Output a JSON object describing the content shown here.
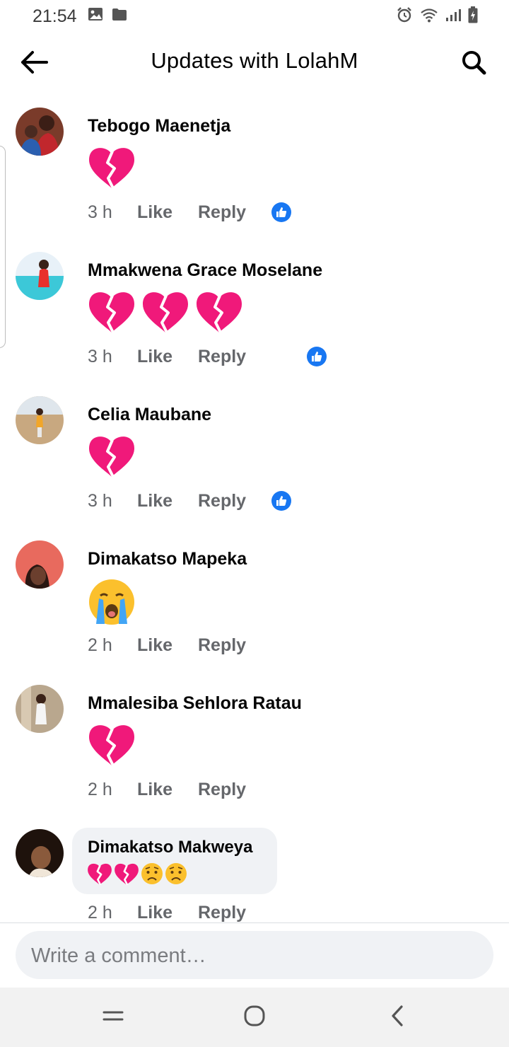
{
  "status_bar": {
    "time": "21:54"
  },
  "header": {
    "title": "Updates with LolahM"
  },
  "comments": [
    {
      "author": "Tebogo Maenetja",
      "reactions": [
        "broken-heart"
      ],
      "time": "3 h",
      "like": "Like",
      "reply": "Reply",
      "likes": "1"
    },
    {
      "author": "Mmakwena Grace Moselane",
      "reactions": [
        "broken-heart",
        "broken-heart",
        "broken-heart"
      ],
      "time": "3 h",
      "like": "Like",
      "reply": "Reply",
      "likes": "1"
    },
    {
      "author": "Celia Maubane",
      "reactions": [
        "broken-heart"
      ],
      "time": "3 h",
      "like": "Like",
      "reply": "Reply",
      "likes": "1"
    },
    {
      "author": "Dimakatso Mapeka",
      "reactions": [
        "loudly-crying-face"
      ],
      "time": "2 h",
      "like": "Like",
      "reply": "Reply"
    },
    {
      "author": "Mmalesiba Sehlora Ratau",
      "reactions": [
        "broken-heart"
      ],
      "time": "2 h",
      "like": "Like",
      "reply": "Reply"
    },
    {
      "author": "Dimakatso Makweya",
      "reactions": [
        "broken-heart",
        "broken-heart",
        "worried-face",
        "worried-face"
      ],
      "time": "2 h",
      "like": "Like",
      "reply": "Reply"
    }
  ],
  "composer": {
    "placeholder": "Write a comment…"
  },
  "colors": {
    "like_blue": "#1877f2",
    "broken_heart": "#f0197a",
    "meta_gray": "#65676b",
    "bubble_bg": "#f0f2f5"
  }
}
